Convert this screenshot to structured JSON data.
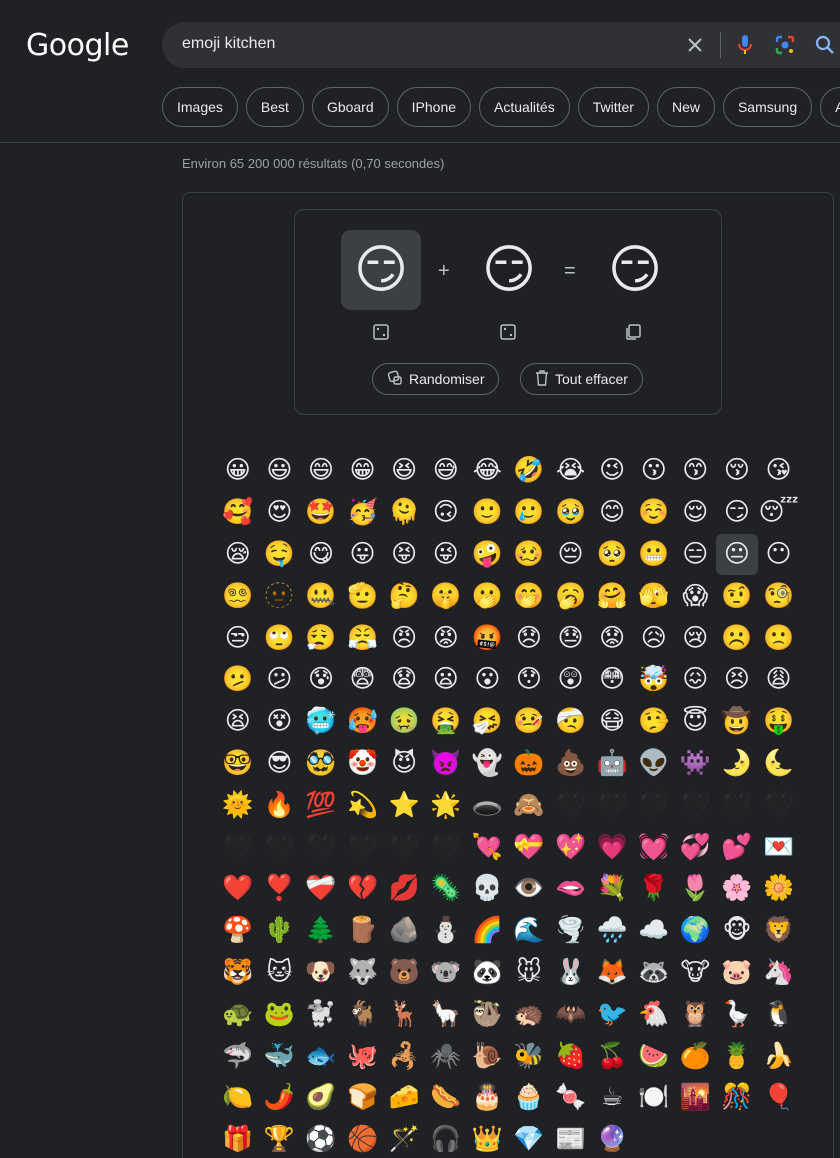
{
  "header": {
    "logo": "Google",
    "query": "emoji kitchen",
    "icons": {
      "clear": "close-icon",
      "voice": "mic-icon",
      "lens": "lens-icon",
      "search": "search-icon"
    }
  },
  "chips": [
    "Images",
    "Best",
    "Gboard",
    "IPhone",
    "Actualités",
    "Twitter",
    "New",
    "Samsung",
    "An"
  ],
  "stats": "Environ 65 200 000 résultats (0,70 secondes)",
  "kitchen": {
    "left_emoji": "😏",
    "plus": "+",
    "right_emoji": "😏",
    "equals": "=",
    "result_emoji": "😏",
    "randomize_label": "Randomiser",
    "clear_label": "Tout effacer"
  },
  "grid": {
    "selected_index": 40,
    "emojis": [
      "😀",
      "😃",
      "😄",
      "😁",
      "😆",
      "😅",
      "😂",
      "🤣",
      "😭",
      "😉",
      "😗",
      "😙",
      "😚",
      "😘",
      "🥰",
      "😍",
      "🤩",
      "🥳",
      "🫠",
      "🙃",
      "🙂",
      "🥲",
      "🥹",
      "😊",
      "☺️",
      "😌",
      "😏",
      "😴",
      "😪",
      "🤤",
      "😋",
      "😛",
      "😝",
      "😜",
      "🤪",
      "🥴",
      "😔",
      "🥺",
      "😬",
      "😑",
      "😐",
      "😶",
      "😵‍💫",
      "🫥",
      "🤐",
      "🫡",
      "🤔",
      "🤫",
      "🫢",
      "🤭",
      "🥱",
      "🤗",
      "🫣",
      "😱",
      "🤨",
      "🧐",
      "😒",
      "🙄",
      "😮‍💨",
      "😤",
      "😠",
      "😡",
      "🤬",
      "😞",
      "😓",
      "😟",
      "😥",
      "😢",
      "☹️",
      "🙁",
      "🫤",
      "😕",
      "😰",
      "😨",
      "😧",
      "😦",
      "😮",
      "😯",
      "😲",
      "😳",
      "🤯",
      "😖",
      "😣",
      "😩",
      "😫",
      "😵",
      "🥶",
      "🥵",
      "🤢",
      "🤮",
      "🤧",
      "🤒",
      "🤕",
      "😷",
      "🤥",
      "😇",
      "🤠",
      "🤑",
      "🤓",
      "😎",
      "🥸",
      "🤡",
      "😈",
      "👿",
      "👻",
      "🎃",
      "💩",
      "🤖",
      "👽",
      "👾",
      "🌛",
      "🌜",
      "🌞",
      "🔥",
      "💯",
      "💫",
      "⭐",
      "🌟",
      "🕳️",
      "🙈",
      "🖤",
      "🖤",
      "🖤",
      "🖤",
      "🖤",
      "🖤",
      "🖤",
      "🖤",
      "🖤",
      "🖤",
      "🖤",
      "🖤",
      "💘",
      "💝",
      "💖",
      "💗",
      "💓",
      "💞",
      "💕",
      "💌",
      "❤️",
      "❣️",
      "❤️‍🩹",
      "💔",
      "💋",
      "🦠",
      "💀",
      "👁️",
      "🫦",
      "💐",
      "🌹",
      "🌷",
      "🌸",
      "🌼",
      "🍄",
      "🌵",
      "🌲",
      "🪵",
      "🪨",
      "⛄",
      "🌈",
      "🌊",
      "🌪️",
      "🌧️",
      "☁️",
      "🌍",
      "🐵",
      "🦁",
      "🐯",
      "🐱",
      "🐶",
      "🐺",
      "🐻",
      "🐨",
      "🐼",
      "🐭",
      "🐰",
      "🦊",
      "🦝",
      "🐮",
      "🐷",
      "🦄",
      "🐢",
      "🐸",
      "🐩",
      "🐐",
      "🦌",
      "🦙",
      "🦥",
      "🦔",
      "🦇",
      "🐦",
      "🐔",
      "🦉",
      "🪿",
      "🐧",
      "🦈",
      "🐳",
      "🐟",
      "🐙",
      "🦂",
      "🕷️",
      "🐌",
      "🐝",
      "🍓",
      "🍒",
      "🍉",
      "🍊",
      "🍍",
      "🍌",
      "🍋",
      "🌶️",
      "🥑",
      "🍞",
      "🧀",
      "🌭",
      "🎂",
      "🧁",
      "🍬",
      "☕",
      "🍽️",
      "🌇",
      "🎊",
      "🎈",
      "🎁",
      "🏆",
      "⚽",
      "🏀",
      "🪄",
      "🎧",
      "👑",
      "💎",
      "📰",
      "🔮"
    ],
    "dim_indices": [
      120,
      121,
      122,
      123,
      124,
      125,
      126,
      127,
      128,
      129,
      130,
      131
    ]
  }
}
